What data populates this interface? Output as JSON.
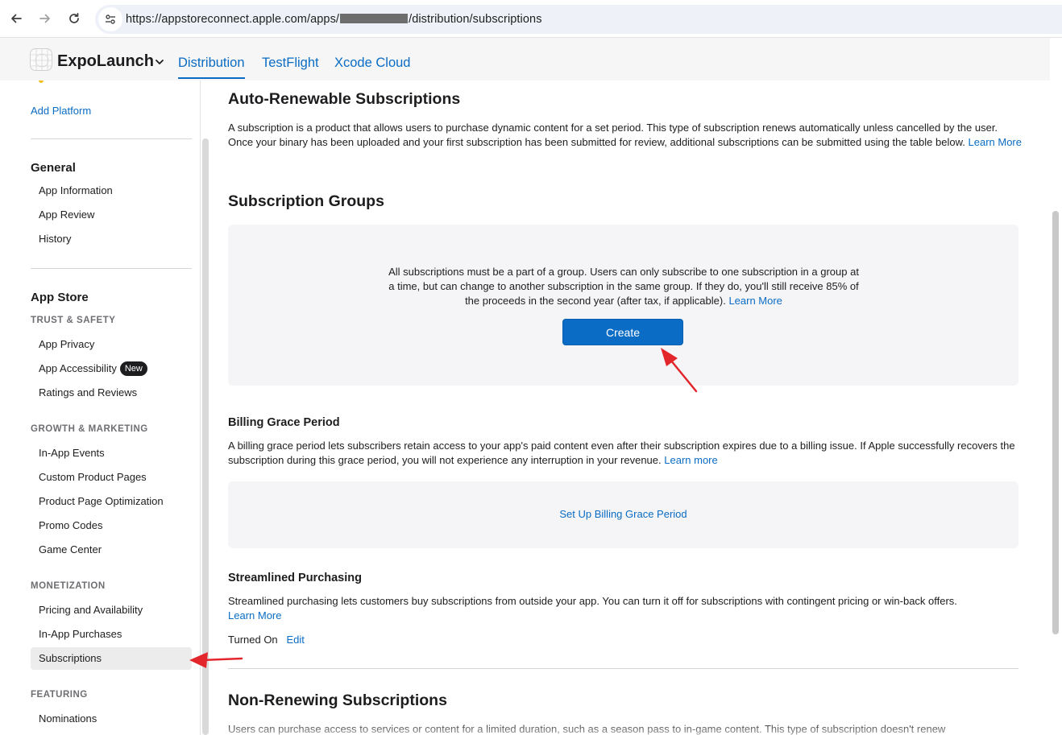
{
  "browser": {
    "url_prefix": "https://appstoreconnect.apple.com/apps/",
    "url_suffix": "/distribution/subscriptions"
  },
  "header": {
    "app_name": "ExpoLaunch",
    "tabs": [
      {
        "label": "Distribution",
        "active": true
      },
      {
        "label": "TestFlight",
        "active": false
      },
      {
        "label": "Xcode Cloud",
        "active": false
      }
    ]
  },
  "sidebar": {
    "add_platform": "Add Platform",
    "general": {
      "heading": "General",
      "items": [
        "App Information",
        "App Review",
        "History"
      ]
    },
    "app_store": {
      "heading": "App Store",
      "trust_safety": {
        "heading": "TRUST & SAFETY",
        "items": [
          "App Privacy",
          "App Accessibility",
          "Ratings and Reviews"
        ],
        "badge": "New"
      },
      "growth_marketing": {
        "heading": "GROWTH & MARKETING",
        "items": [
          "In-App Events",
          "Custom Product Pages",
          "Product Page Optimization",
          "Promo Codes",
          "Game Center"
        ]
      },
      "monetization": {
        "heading": "MONETIZATION",
        "items": [
          "Pricing and Availability",
          "In-App Purchases",
          "Subscriptions"
        ],
        "selected": "Subscriptions"
      },
      "featuring": {
        "heading": "FEATURING",
        "items": [
          "Nominations"
        ]
      }
    }
  },
  "main": {
    "auto_renewable": {
      "title": "Auto-Renewable Subscriptions",
      "description": "A subscription is a product that allows users to purchase dynamic content for a set period. This type of subscription renews automatically unless cancelled by the user. Once your binary has been uploaded and your first subscription has been submitted for review, additional subscriptions can be submitted using the table below.",
      "learn_more": "Learn More"
    },
    "subscription_groups": {
      "title": "Subscription Groups",
      "description": "All subscriptions must be a part of a group. Users can only subscribe to one subscription in a group at a time, but can change to another subscription in the same group. If they do, you'll still receive 85% of the proceeds in the second year (after tax, if applicable).",
      "learn_more": "Learn More",
      "create_button": "Create"
    },
    "billing_grace": {
      "title": "Billing Grace Period",
      "description": "A billing grace period lets subscribers retain access to your app's paid content even after their subscription expires due to a billing issue. If Apple successfully recovers the subscription during this grace period, you will not experience any interruption in your revenue.",
      "learn_more": "Learn more",
      "setup_link": "Set Up Billing Grace Period"
    },
    "streamlined": {
      "title": "Streamlined Purchasing",
      "description": "Streamlined purchasing lets customers buy subscriptions from outside your app. You can turn it off for subscriptions with contingent pricing or win-back offers.",
      "learn_more": "Learn More",
      "status": "Turned On",
      "edit": "Edit"
    },
    "non_renewing": {
      "title": "Non-Renewing Subscriptions",
      "description": "Users can purchase access to services or content for a limited duration, such as a season pass to in-game content. This type of subscription doesn't renew"
    }
  },
  "colors": {
    "accent": "#0a6cc4",
    "annotation_arrow": "#e3262b"
  }
}
